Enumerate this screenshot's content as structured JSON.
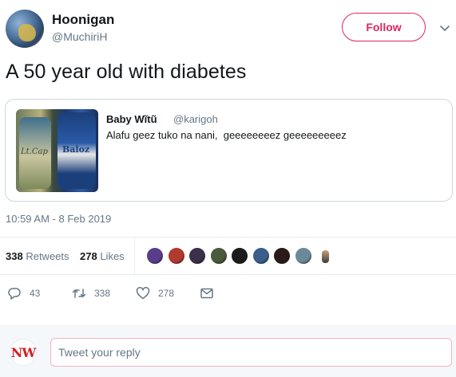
{
  "header": {
    "display_name": "Hoonigan",
    "handle": "@MuchiriH",
    "follow_label": "Follow"
  },
  "tweet": {
    "text": "A 50 year old with diabetes",
    "timestamp": "10:59 AM - 8 Feb 2019"
  },
  "quote": {
    "name": "Baby Wĩtũ",
    "handle": "@karigoh",
    "text": "Alafu geez tuko na nani,  geeeeeeeez geeeeeeeeez",
    "image_labels": [
      "Baloz",
      "Lt.Cap"
    ]
  },
  "stats": {
    "retweets_count": "338",
    "retweets_label": "Retweets",
    "likes_count": "278",
    "likes_label": "Likes",
    "liker_colors": [
      "#5a3d8a",
      "#b03a2e",
      "#3b2f4a",
      "#4a5a3a",
      "#1c1c1c",
      "#3a5f8a",
      "#2a1a1a",
      "#6a8a9a",
      "#e8c9a0"
    ]
  },
  "actions": {
    "reply_count": "43",
    "retweet_count": "338",
    "like_count": "278"
  },
  "reply": {
    "avatar_text": "NW",
    "placeholder": "Tweet your reply"
  },
  "colors": {
    "accent": "#e0245e",
    "muted": "#657786",
    "text": "#14171a",
    "border": "#e6ecf0"
  }
}
